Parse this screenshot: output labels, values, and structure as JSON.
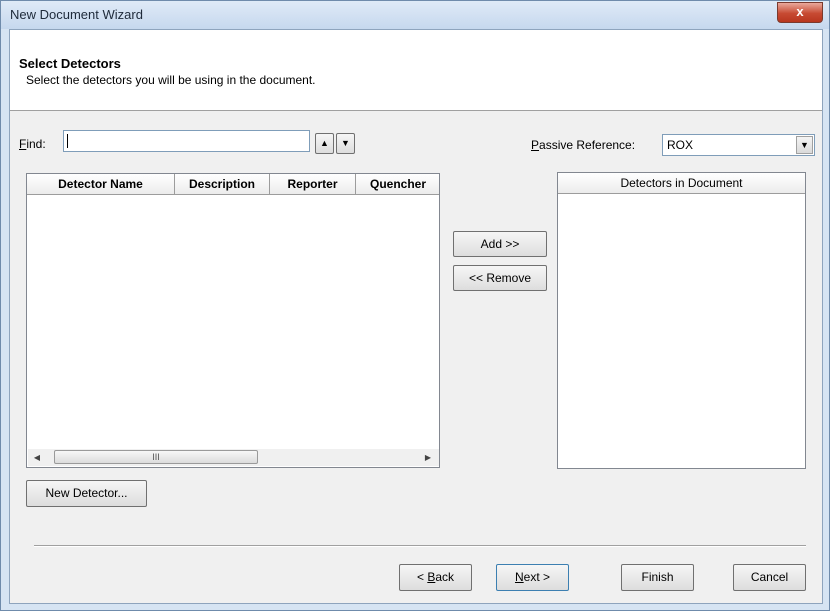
{
  "window": {
    "title": "New Document Wizard",
    "close_glyph": "x"
  },
  "header": {
    "title": "Select Detectors",
    "subtitle": "Select the detectors you will be using in the document."
  },
  "find": {
    "label_mnemonic": "F",
    "label_rest": "ind:",
    "value": ""
  },
  "search_buttons": {
    "up_glyph": "▲",
    "down_glyph": "▼"
  },
  "passive_reference": {
    "label_mnemonic": "P",
    "label_rest": "assive Reference:",
    "value": "ROX"
  },
  "available_list": {
    "columns": [
      "Detector Name",
      "Description",
      "Reporter",
      "Quencher"
    ],
    "rows": [],
    "scroll_thumb_glyph": "III"
  },
  "transfer": {
    "add_label": "Add >>",
    "remove_label": "<< Remove"
  },
  "document_list": {
    "header": "Detectors in Document",
    "rows": []
  },
  "new_detector_label": "New Detector...",
  "nav": {
    "back_prefix": "< ",
    "back_mnemonic": "B",
    "back_rest": "ack",
    "next_mnemonic": "N",
    "next_rest": "ext >",
    "finish_label": "Finish",
    "cancel_label": "Cancel"
  }
}
